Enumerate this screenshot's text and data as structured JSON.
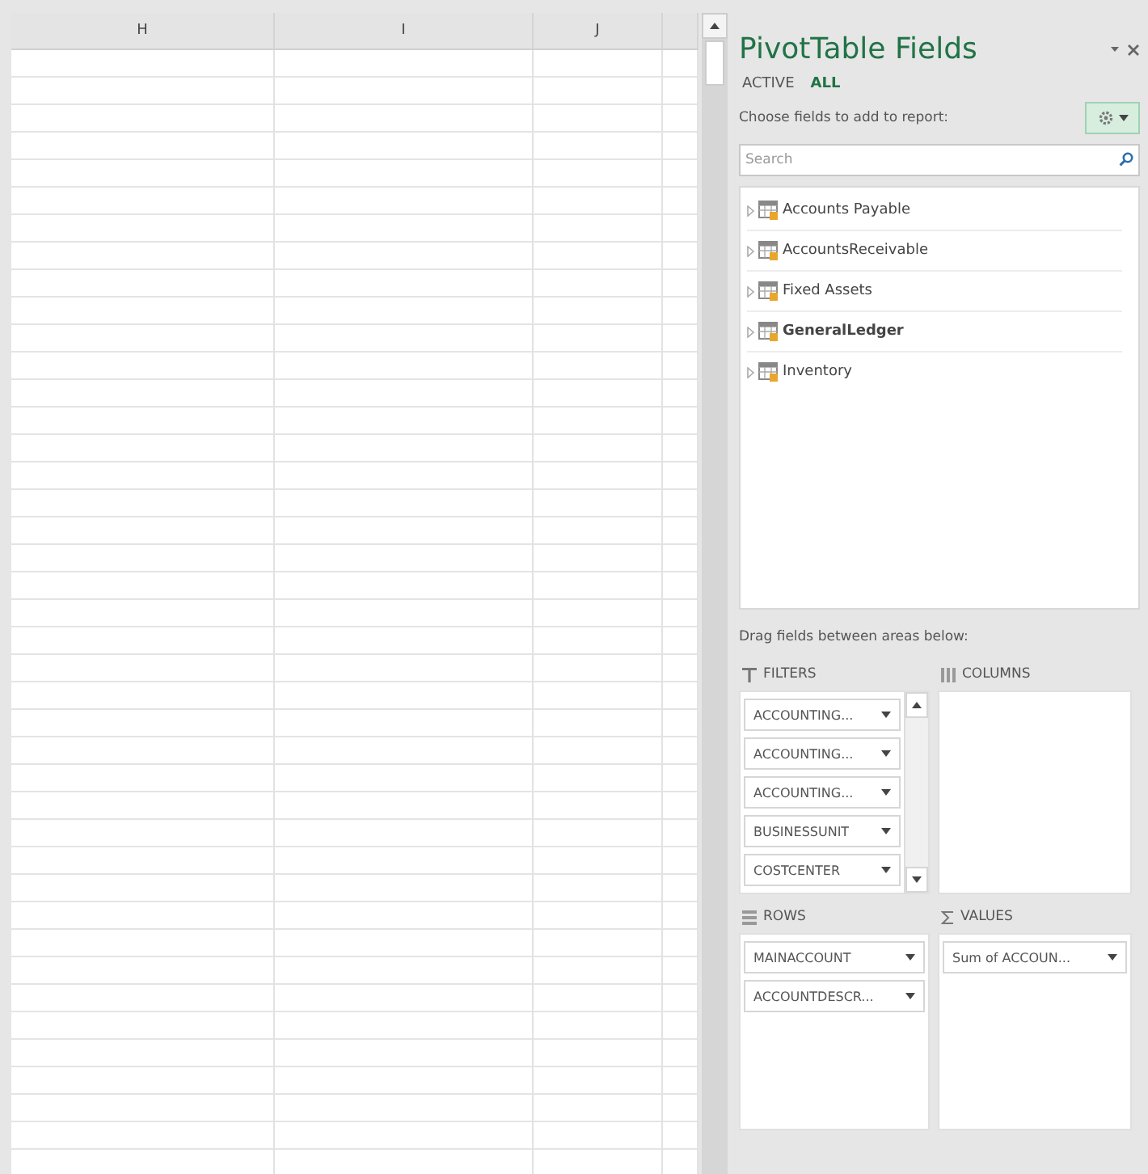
{
  "sheet": {
    "columns": [
      {
        "label": "H"
      },
      {
        "label": "I"
      },
      {
        "label": "J"
      },
      {}
    ]
  },
  "pivot_panel": {
    "title": "PivotTable Fields",
    "tabs": [
      {
        "label": "ACTIVE",
        "selected": false
      },
      {
        "label": "ALL",
        "selected": true
      }
    ],
    "choose_label": "Choose fields to add to report:",
    "search": {
      "placeholder": "Search"
    },
    "tables": [
      {
        "name": "Accounts Payable",
        "in_use": false
      },
      {
        "name": "AccountsReceivable",
        "in_use": false
      },
      {
        "name": "Fixed Assets",
        "in_use": false
      },
      {
        "name": "GeneralLedger",
        "in_use": true
      },
      {
        "name": "Inventory",
        "in_use": false
      }
    ],
    "areas_hint": "Drag fields between areas below:",
    "areas": [
      {
        "kind": "filters",
        "label": "FILTERS",
        "fields": [
          "ACCOUNTING...",
          "ACCOUNTING...",
          "ACCOUNTING...",
          "BUSINESSUNIT",
          "COSTCENTER"
        ]
      },
      {
        "kind": "columns",
        "label": "COLUMNS"
      },
      {
        "kind": "rows",
        "label": "ROWS",
        "fields": [
          "MAINACCOUNT",
          "ACCOUNTDESCR..."
        ]
      },
      {
        "kind": "values",
        "label": "VALUES",
        "fields": [
          "Sum of ACCOUN..."
        ]
      }
    ]
  }
}
